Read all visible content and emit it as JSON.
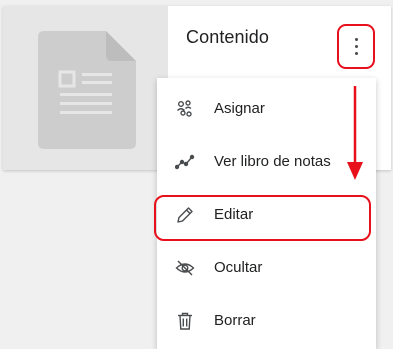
{
  "card": {
    "title": "Contenido",
    "thumbnail_icon": "document-icon",
    "menu_icon": "kebab-icon"
  },
  "menu": {
    "items": [
      {
        "label": "Asignar",
        "icon": "assign-users-icon"
      },
      {
        "label": "Ver libro de notas",
        "icon": "chart-line-icon"
      },
      {
        "label": "Editar",
        "icon": "pencil-icon"
      },
      {
        "label": "Ocultar",
        "icon": "eye-slash-icon"
      },
      {
        "label": "Borrar",
        "icon": "trash-icon"
      }
    ]
  },
  "colors": {
    "annotation": "#e8101b",
    "thumbnail_bg": "#e6e6e6",
    "doc_icon": "#cdcdcd"
  }
}
